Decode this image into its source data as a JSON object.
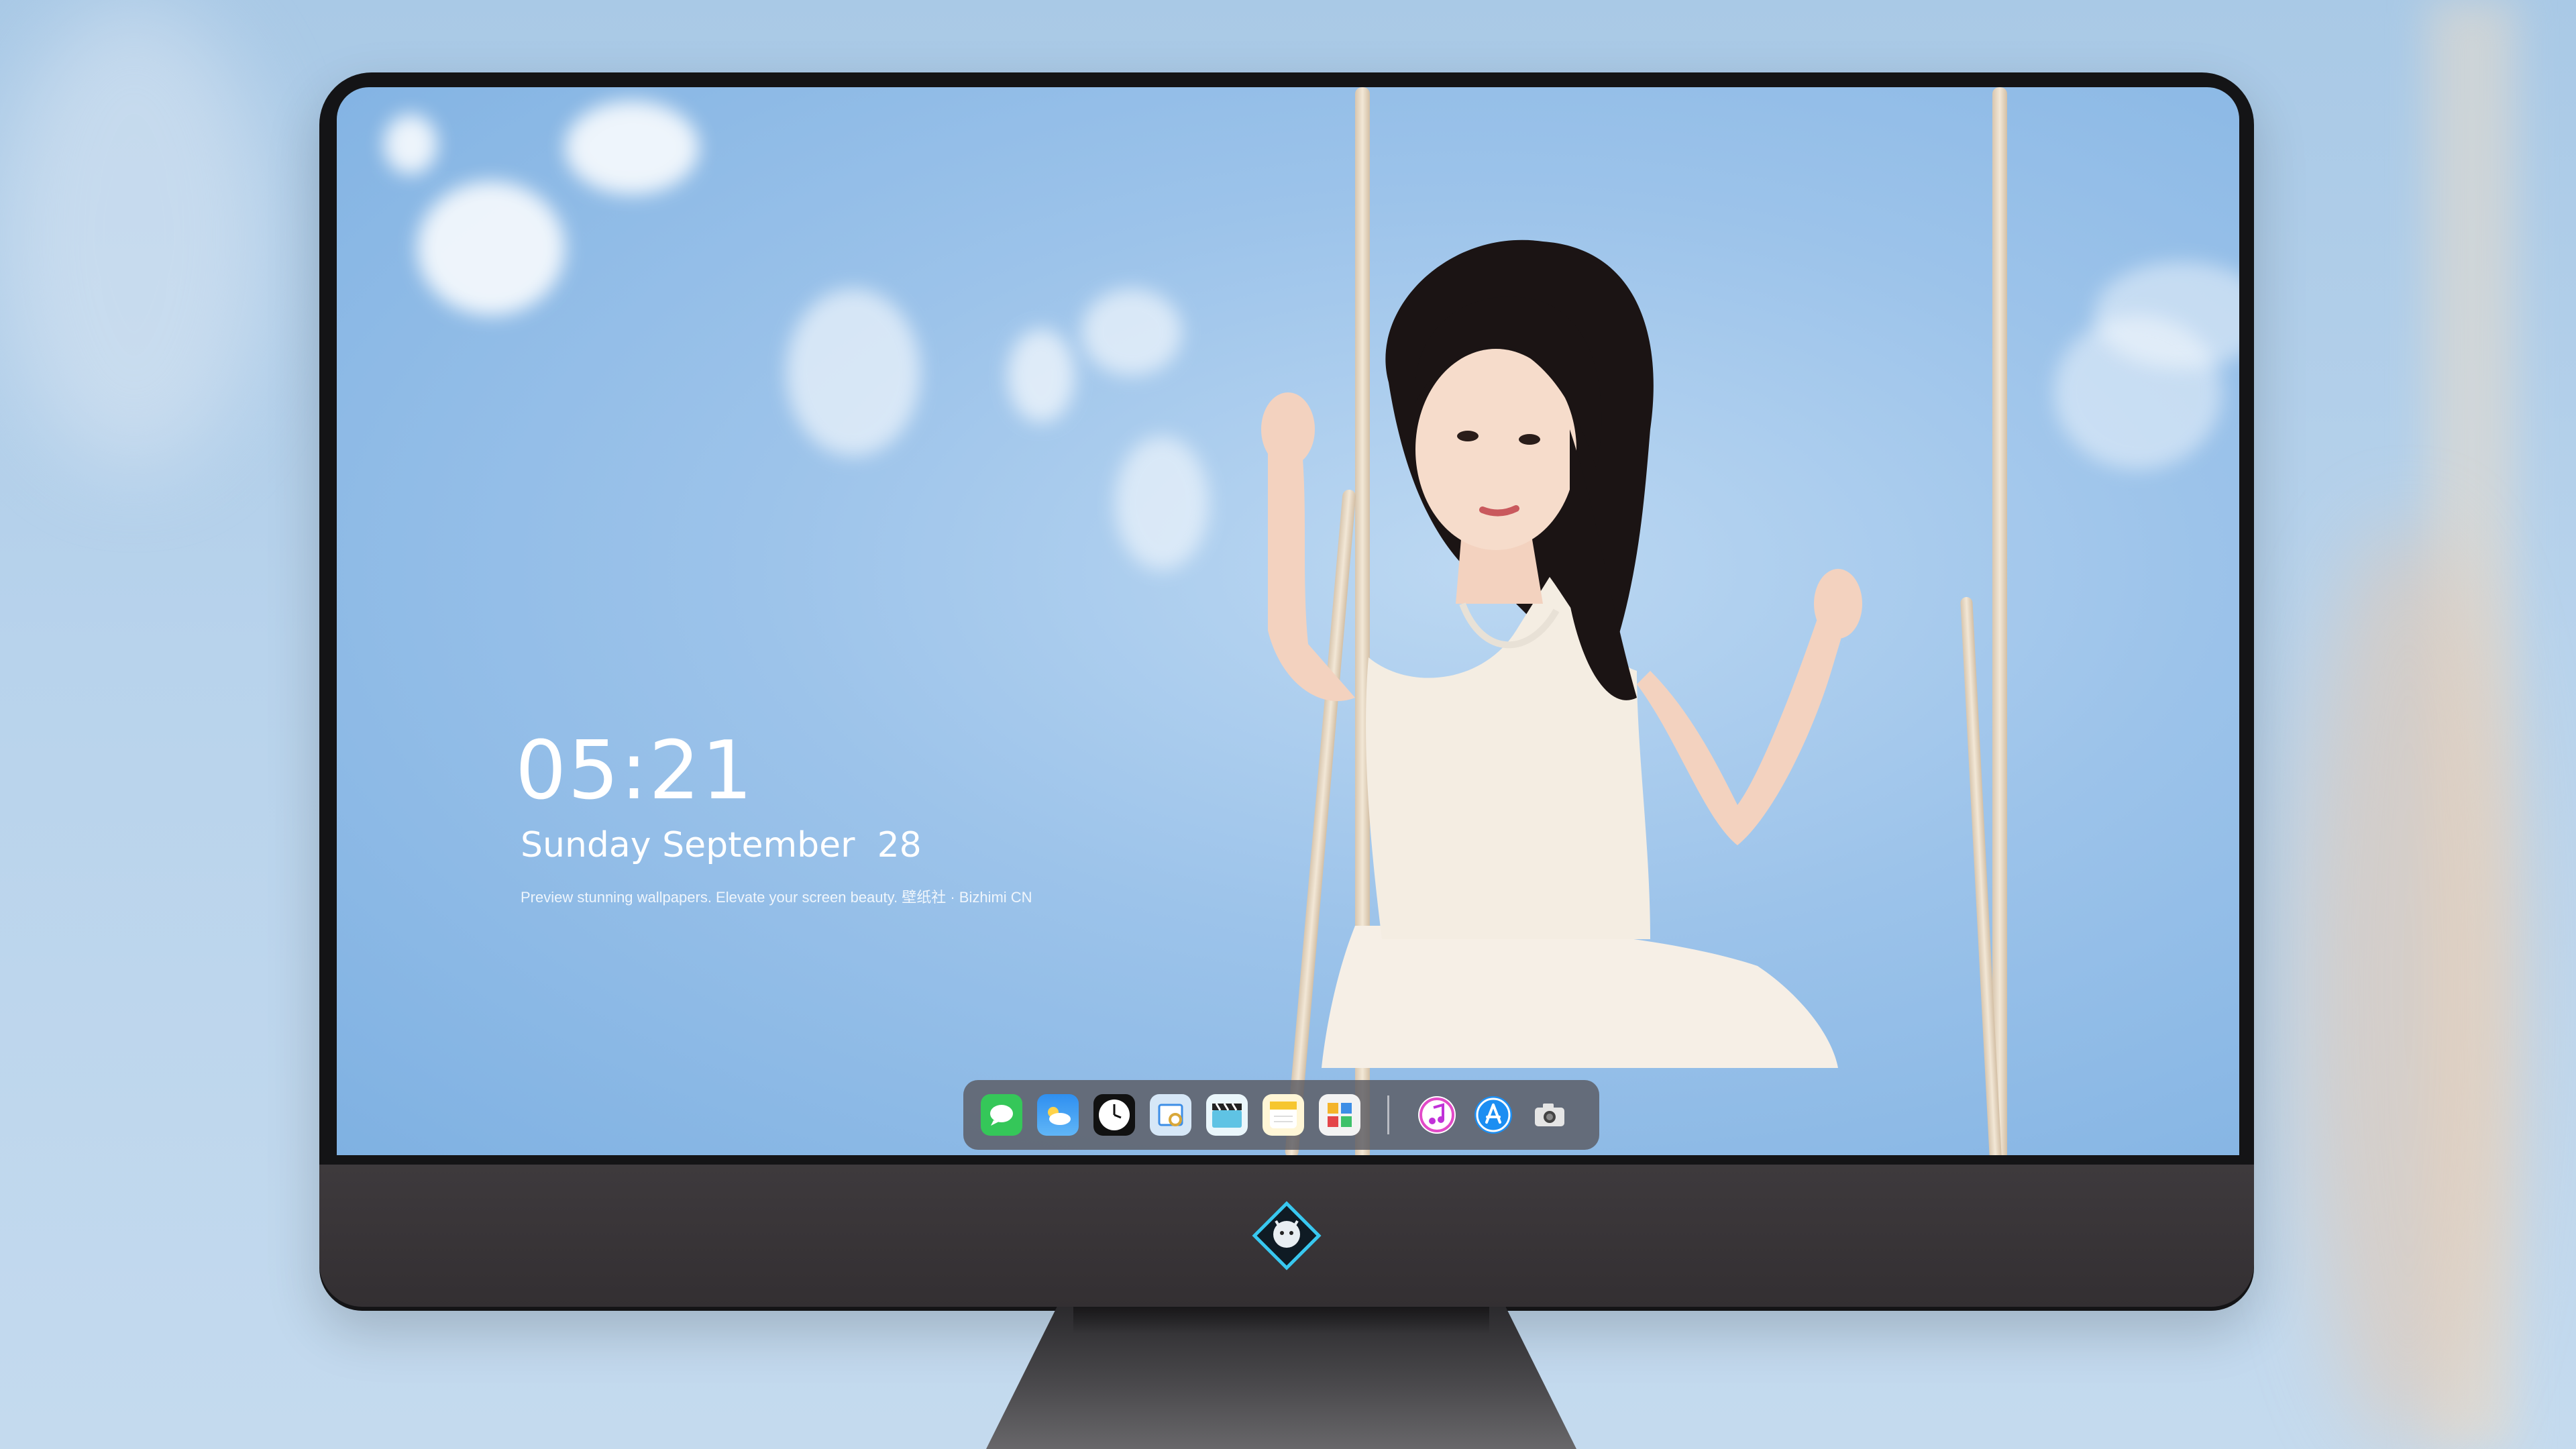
{
  "lock_screen": {
    "time": "05:21",
    "date": "Sunday September  28",
    "tagline": "Preview stunning wallpapers. Elevate your screen beauty. 壁纸社 · Bizhimi CN"
  },
  "dock": {
    "apps": [
      {
        "icon": "messages-icon"
      },
      {
        "icon": "weather-icon"
      },
      {
        "icon": "clock-icon"
      },
      {
        "icon": "preview-icon"
      },
      {
        "icon": "clapper-icon"
      },
      {
        "icon": "notes-icon"
      },
      {
        "icon": "photos-icon"
      },
      {
        "icon": "music-icon"
      },
      {
        "icon": "app-store-icon"
      },
      {
        "icon": "camera-icon"
      }
    ]
  },
  "colors": {
    "sky": "#9cc3ea",
    "bezel": "#141416",
    "chin": "#3a3639",
    "dock": "#5a5a62"
  }
}
